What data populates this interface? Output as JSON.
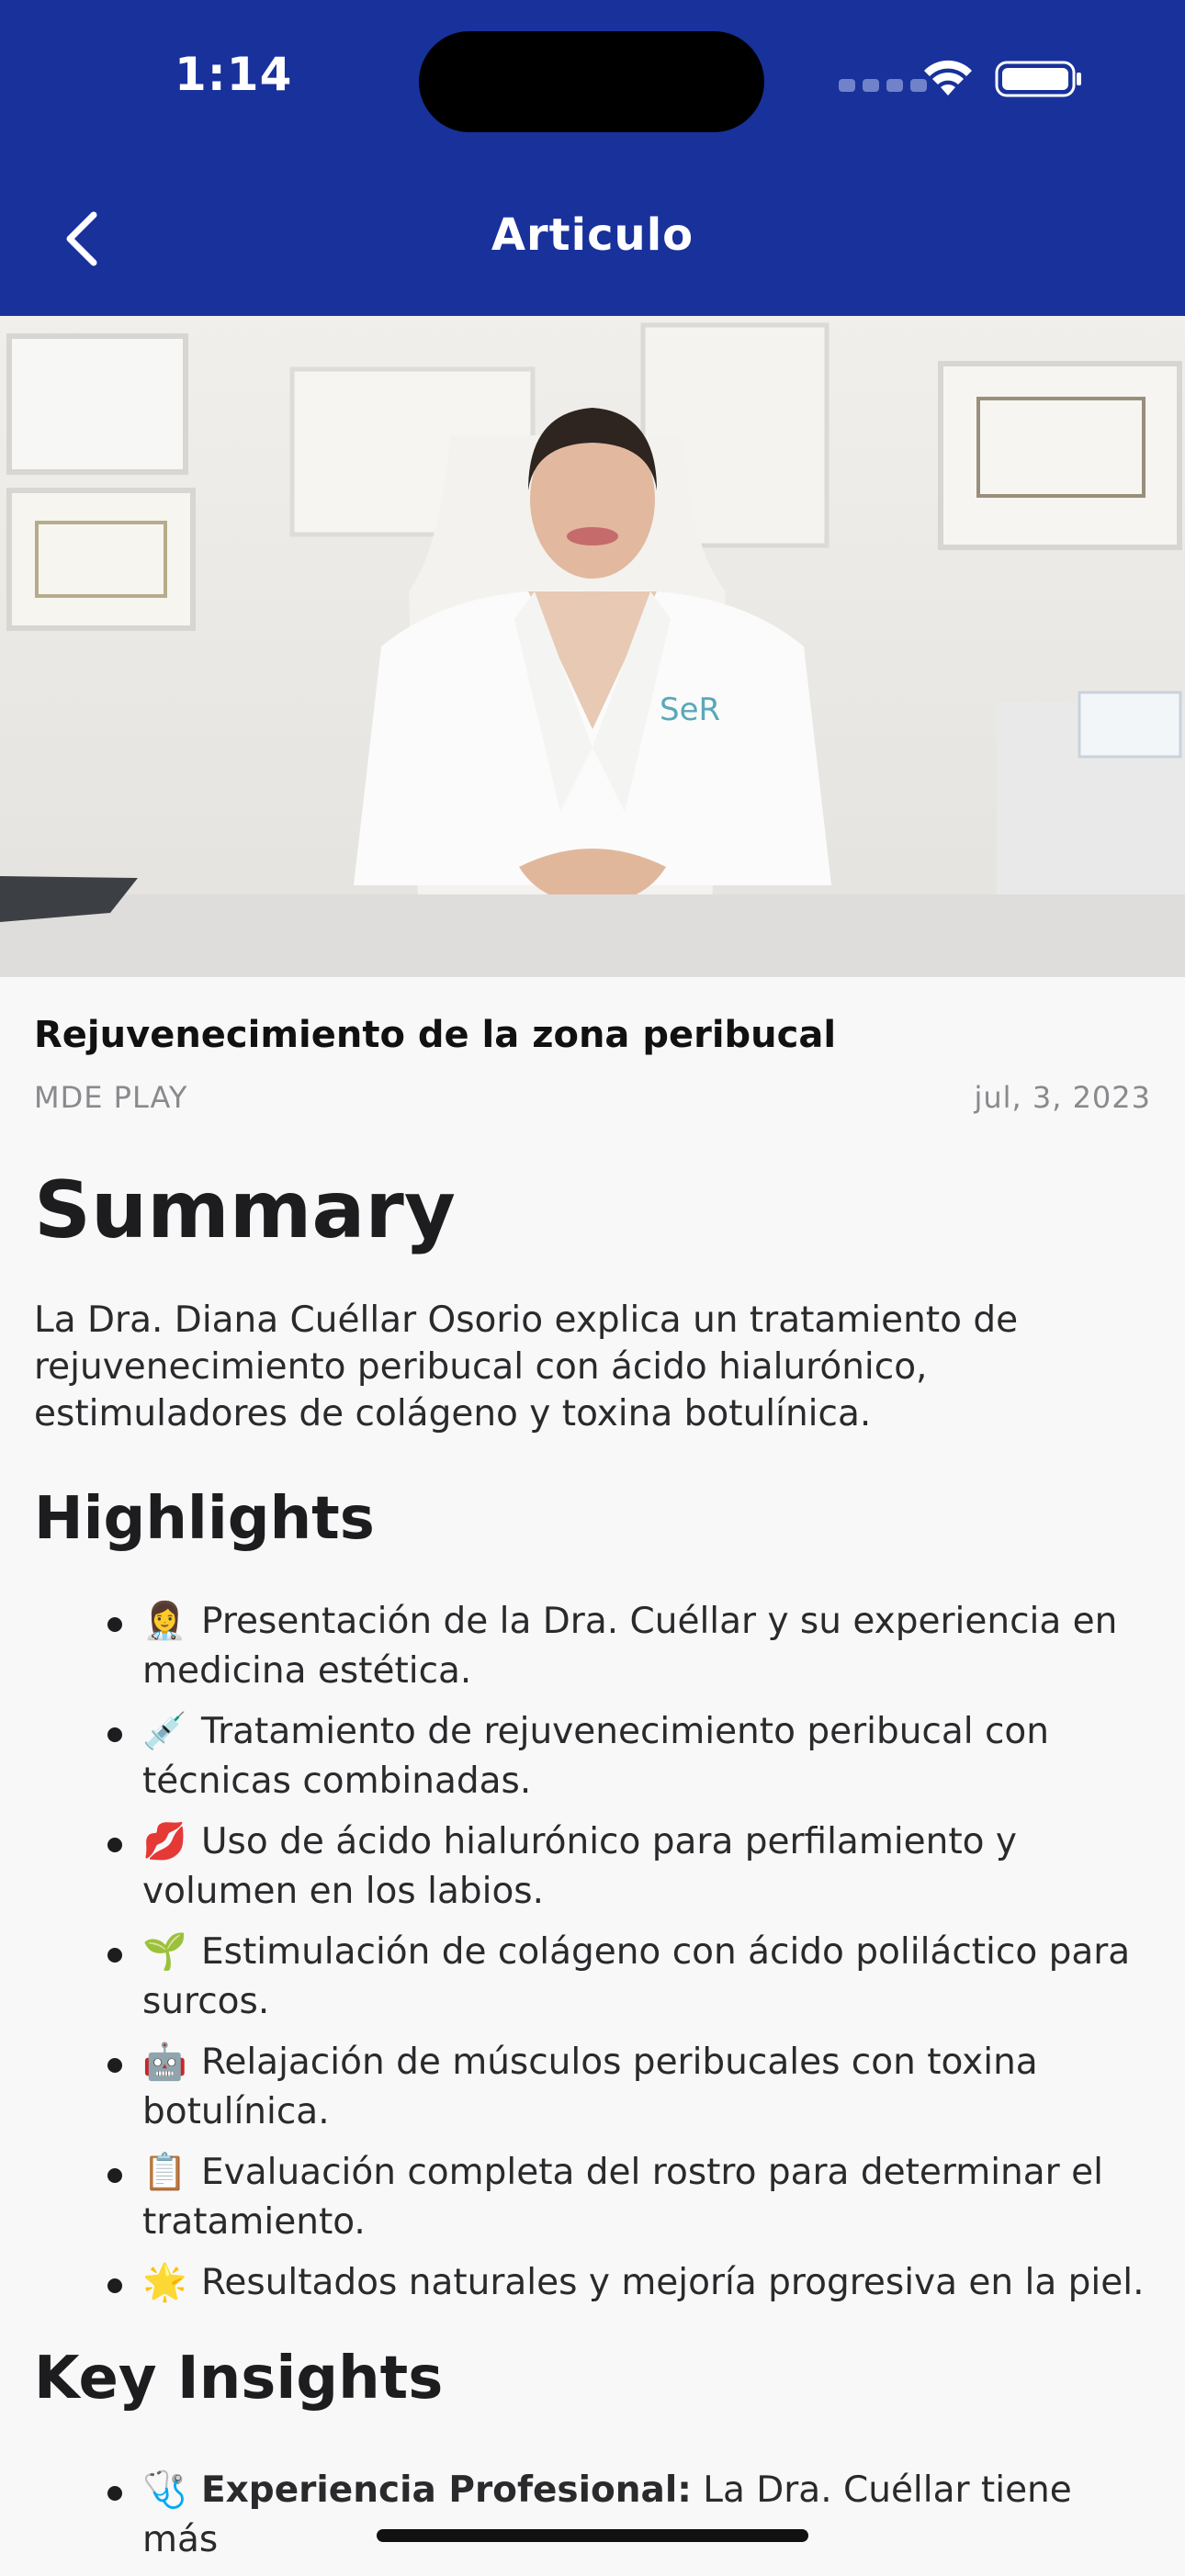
{
  "status_bar": {
    "time": "1:14"
  },
  "nav": {
    "title": "Articulo"
  },
  "article": {
    "title": "Rejuvenecimiento de la zona peribucal",
    "source": "MDE PLAY",
    "date": "jul, 3, 2023",
    "hero_image": "doctor-video-thumbnail"
  },
  "summary": {
    "heading": "Summary",
    "text": "La Dra. Diana Cuéllar Osorio explica un tratamiento de rejuvenecimiento peribucal con ácido hialurónico, estimuladores de colágeno y toxina botulínica."
  },
  "highlights": {
    "heading": "Highlights",
    "items": [
      {
        "emoji": "👩‍⚕️",
        "text": "Presentación de la Dra. Cuéllar y su experiencia en medicina estética."
      },
      {
        "emoji": "💉",
        "text": "Tratamiento de rejuvenecimiento peribucal con técnicas combinadas."
      },
      {
        "emoji": "💋",
        "text": "Uso de ácido hialurónico para perfilamiento y volumen en los labios."
      },
      {
        "emoji": "🌱",
        "text": "Estimulación de colágeno con ácido poliláctico para surcos."
      },
      {
        "emoji": "🤖",
        "text": "Relajación de músculos peribucales con toxina botulínica."
      },
      {
        "emoji": "📋",
        "text": "Evaluación completa del rostro para determinar el tratamiento."
      },
      {
        "emoji": "🌟",
        "text": "Resultados naturales y mejoría progresiva en la piel."
      }
    ]
  },
  "key_insights": {
    "heading": "Key Insights",
    "first_item": {
      "emoji": "🩺",
      "label": "Experiencia Profesional:",
      "text": " La Dra. Cuéllar tiene más"
    }
  },
  "colors": {
    "header_bg": "#18319b",
    "page_bg": "#f8f8f8",
    "meta_text": "#8a8a8e"
  }
}
